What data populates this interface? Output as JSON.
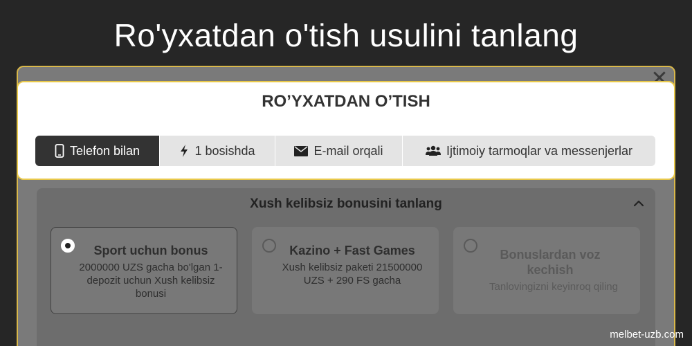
{
  "headline": "Ro'yxatdan o'tish usulini tanlang",
  "modal": {
    "close_icon": "close-icon",
    "title": "RO’YXATDAN O’TISH",
    "tabs": [
      {
        "label": "Telefon bilan",
        "icon": "phone-icon",
        "active": true
      },
      {
        "label": "1 bosishda",
        "icon": "lightning-icon",
        "active": false
      },
      {
        "label": "E-mail orqali",
        "icon": "envelope-icon",
        "active": false
      },
      {
        "label": "Ijtimoiy tarmoqlar va messenjerlar",
        "icon": "users-icon",
        "active": false
      }
    ],
    "bonus": {
      "title": "Xush kelibsiz bonusini tanlang",
      "chevron_icon": "chevron-up-icon",
      "cards": [
        {
          "title": "Sport uchun bonus",
          "description": "2000000 UZS gacha bo'lgan 1-depozit uchun Xush kelibsiz bonusi",
          "selected": true
        },
        {
          "title": "Kazino + Fast Games",
          "description": "Xush kelibsiz paketi 21500000 UZS + 290 FS gacha",
          "selected": false
        },
        {
          "title": "Bonuslardan voz kechish",
          "description": "Tanlovingizni keyinroq qiling",
          "selected": false
        }
      ]
    }
  },
  "watermark": "melbet-uzb.com",
  "colors": {
    "accent": "#e8c84a",
    "active_tab": "#333333",
    "background": "#262626"
  }
}
